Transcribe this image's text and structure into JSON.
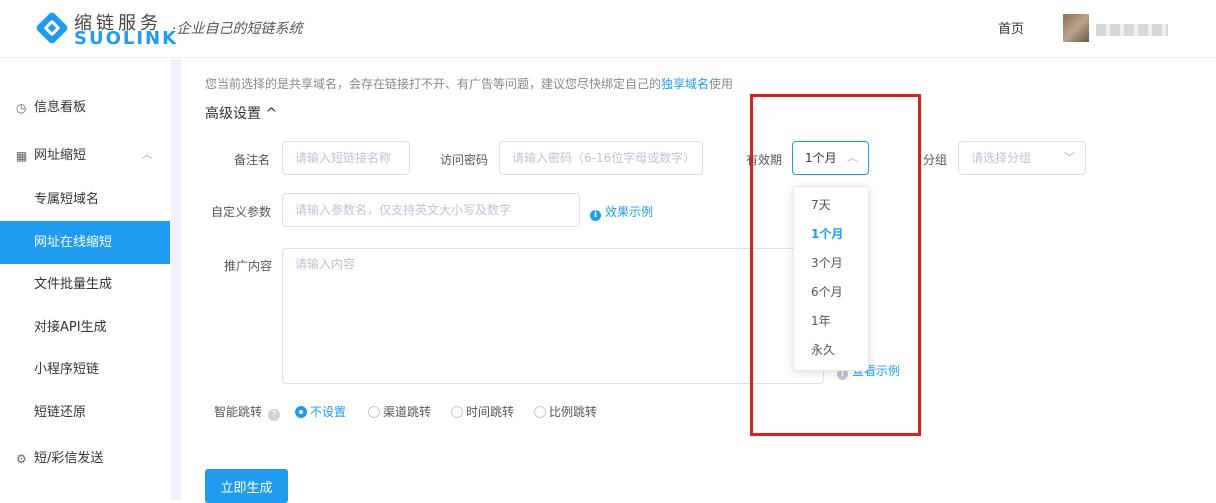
{
  "header": {
    "logo_cn": "缩链服务",
    "logo_en": "SUOLINK",
    "tagline": "·企业自己的短链系统",
    "nav_home": "首页"
  },
  "sidebar": {
    "items": [
      {
        "label": "信息看板",
        "icon": "clock-icon"
      },
      {
        "label": "网址缩短",
        "icon": "grid-icon"
      },
      {
        "label": "专属短域名"
      },
      {
        "label": "网址在线缩短",
        "active": true
      },
      {
        "label": "文件批量生成"
      },
      {
        "label": "对接API生成"
      },
      {
        "label": "小程序短链"
      },
      {
        "label": "短链还原"
      },
      {
        "label": "短/彩信发送",
        "icon": "gear-icon"
      }
    ]
  },
  "main": {
    "notice_prefix": "您当前选择的是共享域名，会存在链接打不开、有广告等问题，建议您尽快绑定自己的",
    "notice_link": "独享域名",
    "notice_suffix": "使用",
    "advanced_title": "高级设置 ^",
    "remark_label": "备注名",
    "remark_placeholder": "请输入短链接名称",
    "password_label": "访问密码",
    "password_placeholder": "请输入密码（6-16位字母或数字）",
    "validity_label": "有效期",
    "validity_value": "1个月",
    "group_label": "分组",
    "group_placeholder": "请选择分组",
    "params_label": "自定义参数",
    "params_placeholder": "请输入参数名，仅支持英文大小写及数字",
    "effect_example": "效果示例",
    "promo_label": "推广内容",
    "promo_placeholder": "请输入内容",
    "view_example": "查看示例",
    "smart_jump_label": "智能跳转",
    "radios": [
      "不设置",
      "渠道跳转",
      "时间跳转",
      "比例跳转"
    ],
    "submit": "立即生成"
  },
  "dropdown": {
    "options": [
      "7天",
      "1个月",
      "3个月",
      "6个月",
      "1年",
      "永久"
    ],
    "selected": "1个月"
  },
  "colors": {
    "accent": "#1f9cf0",
    "highlight": "#e01e1e"
  }
}
